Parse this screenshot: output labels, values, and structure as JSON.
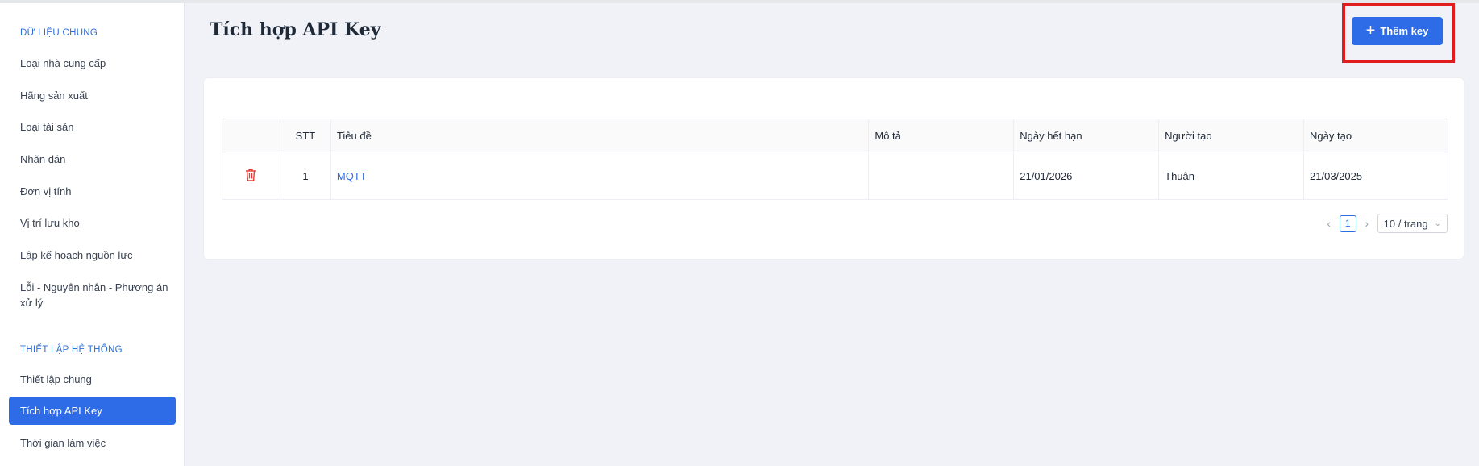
{
  "sidebar": {
    "section1": "DỮ LIỆU CHUNG",
    "items1": [
      "Loại nhà cung cấp",
      "Hãng sản xuất",
      "Loại tài sản",
      "Nhãn dán",
      "Đơn vị tính",
      "Vị trí lưu kho",
      "Lập kế hoạch nguồn lực",
      "Lỗi - Nguyên nhân - Phương án xử lý"
    ],
    "section2": "THIẾT LẬP HỆ THỐNG",
    "items2": [
      "Thiết lập chung",
      "Tích hợp API Key",
      "Thời gian làm việc"
    ]
  },
  "header": {
    "title": "Tích hợp API Key",
    "add_label": "Thêm key"
  },
  "table": {
    "columns": [
      "STT",
      "Tiêu đề",
      "Mô tả",
      "Ngày hết hạn",
      "Người tạo",
      "Ngày tạo"
    ],
    "rows": [
      {
        "stt": "1",
        "title": "MQTT",
        "description": "",
        "expiry": "21/01/2026",
        "creator": "Thuận",
        "created": "21/03/2025"
      }
    ]
  },
  "pagination": {
    "current": "1",
    "page_size": "10 / trang"
  },
  "colors": {
    "accent": "#2e6be6",
    "highlight": "#e11d1d",
    "danger": "#e53935"
  }
}
